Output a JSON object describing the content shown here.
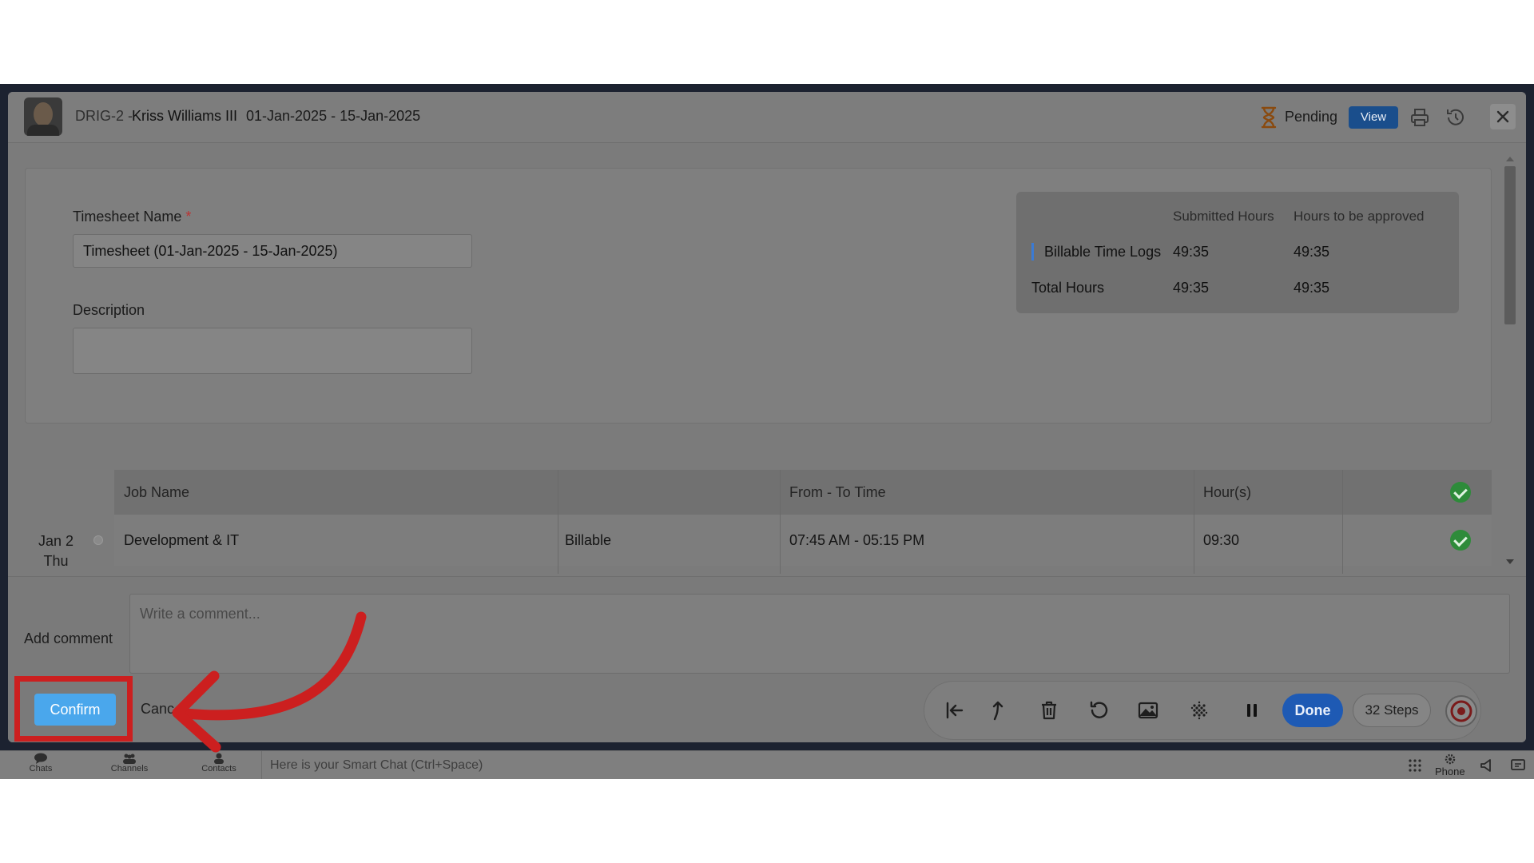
{
  "header": {
    "code": "DRIG-2 -",
    "employee_name": "Kriss Williams III",
    "date_range": "01-Jan-2025 - 15-Jan-2025",
    "status": "Pending",
    "view_label": "View",
    "icons": [
      "hourglass-icon",
      "print-icon",
      "history-icon",
      "close-icon"
    ]
  },
  "form": {
    "timesheet_name_label": "Timesheet Name",
    "required_mark": "*",
    "timesheet_name_value": "Timesheet (01-Jan-2025 - 15-Jan-2025)",
    "description_label": "Description",
    "description_value": ""
  },
  "summary": {
    "col_submitted": "Submitted Hours",
    "col_to_approve": "Hours to be approved",
    "rows": [
      {
        "label": "Billable Time Logs",
        "submitted": "49:35",
        "to_approve": "49:35"
      },
      {
        "label": "Total Hours",
        "submitted": "49:35",
        "to_approve": "49:35"
      }
    ]
  },
  "table": {
    "headers": [
      "Job Name",
      "",
      "From - To Time",
      "Hour(s)"
    ],
    "rows": [
      {
        "date": "Jan 2",
        "day": "Thu",
        "job_name": "Development & IT",
        "billing": "Billable",
        "time_range": "07:45 AM - 05:15 PM",
        "hours": "09:30"
      }
    ]
  },
  "footer": {
    "add_comment_label": "Add comment",
    "comment_placeholder": "Write a comment...",
    "confirm_label": "Confirm",
    "cancel_label": "Canc"
  },
  "recorder_toolbar": {
    "icons": [
      "skip-back-icon",
      "arrow-up-icon",
      "trash-icon",
      "undo-icon",
      "image-icon",
      "blur-icon",
      "pause-icon"
    ],
    "done_label": "Done",
    "steps_label": "32 Steps"
  },
  "bottom_bar": {
    "items": [
      "Chats",
      "Channels",
      "Contacts"
    ],
    "smart_chat_placeholder": "Here is your Smart Chat (Ctrl+Space)",
    "phone_label": "Phone"
  },
  "colors": {
    "annotation_red": "#cc1f1f",
    "confirm_blue": "#4aa7ec",
    "done_blue": "#1e5ab4",
    "view_blue": "#1a4e8c",
    "check_green": "#2e8b3a"
  }
}
